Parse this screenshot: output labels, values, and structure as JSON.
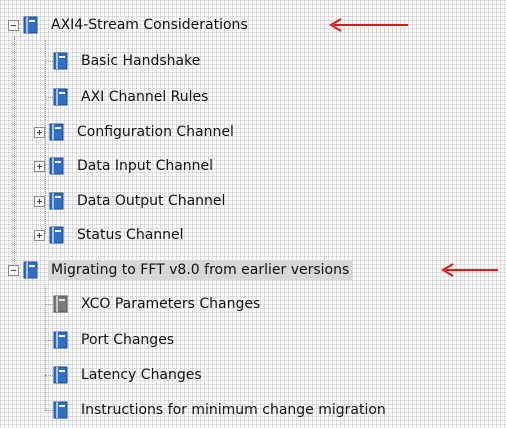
{
  "tree": {
    "groups": [
      {
        "label": "AXI4-Stream Considerations",
        "expanded": true,
        "children": [
          {
            "label": "Basic Handshake",
            "expandable": false,
            "icon": "blue-book-icon"
          },
          {
            "label": "AXI Channel Rules",
            "expandable": false,
            "icon": "blue-book-icon"
          },
          {
            "label": "Configuration Channel",
            "expandable": true,
            "icon": "blue-book-icon"
          },
          {
            "label": "Data Input Channel",
            "expandable": true,
            "icon": "blue-book-icon"
          },
          {
            "label": "Data Output Channel",
            "expandable": true,
            "icon": "blue-book-icon"
          },
          {
            "label": "Status Channel",
            "expandable": true,
            "icon": "blue-book-icon"
          }
        ]
      },
      {
        "label": "Migrating to FFT v8.0 from earlier versions",
        "expanded": true,
        "selected": true,
        "children": [
          {
            "label": "XCO Parameters Changes",
            "expandable": false,
            "icon": "gray-book-icon"
          },
          {
            "label": "Port Changes",
            "expandable": false,
            "icon": "blue-book-icon"
          },
          {
            "label": "Latency Changes",
            "expandable": false,
            "icon": "blue-book-icon"
          },
          {
            "label": "Instructions for minimum change migration",
            "expandable": false,
            "icon": "blue-book-icon"
          }
        ]
      }
    ]
  },
  "colors": {
    "arrow": "#e8161b",
    "book_blue": "#2f6fc4",
    "book_gray": "#7a7a7a",
    "selection": "#d2d2d2"
  }
}
